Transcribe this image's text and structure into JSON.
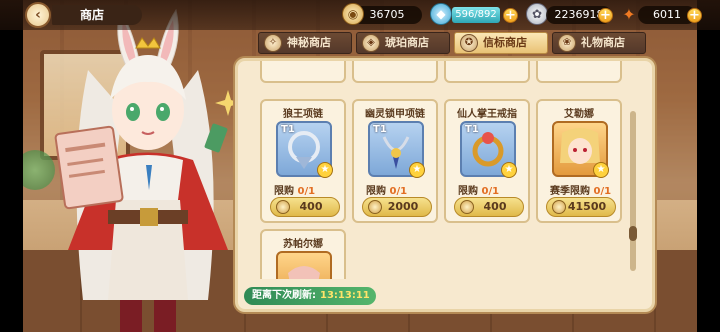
{
  "header": {
    "back_icon": "back-arrow-icon",
    "title": "商店"
  },
  "resources": [
    {
      "name": "gold",
      "value": "36705"
    },
    {
      "name": "stamina",
      "value": "596/892"
    },
    {
      "name": "silver",
      "value": "2236918"
    },
    {
      "name": "carrot",
      "value": "6011"
    }
  ],
  "tabs": [
    {
      "label": "神秘商店",
      "icon": "mystery-icon",
      "active": false
    },
    {
      "label": "琥珀商店",
      "icon": "amber-icon",
      "active": false
    },
    {
      "label": "信标商店",
      "icon": "beacon-icon",
      "active": true
    },
    {
      "label": "礼物商店",
      "icon": "gift-icon",
      "active": false
    }
  ],
  "items": [
    {
      "name": "狼王项链",
      "tier": "T1",
      "limit_label": "限购",
      "limit": "0/1",
      "price": "400",
      "frame": "blue"
    },
    {
      "name": "幽灵锁甲项链",
      "tier": "T1",
      "limit_label": "限购",
      "limit": "0/1",
      "price": "2000",
      "frame": "blue"
    },
    {
      "name": "仙人掌王戒指",
      "tier": "T1",
      "limit_label": "限购",
      "limit": "0/1",
      "price": "400",
      "frame": "blue"
    },
    {
      "name": "艾勒娜",
      "tier": "",
      "limit_label": "赛季限购",
      "limit": "0/1",
      "price": "41500",
      "frame": "gold"
    },
    {
      "name": "苏帕尔娜",
      "tier": "",
      "limit_label": "",
      "limit": "",
      "price": "",
      "frame": "gold"
    }
  ],
  "refresh": {
    "label": "距离下次刷新:",
    "time": "13:13:11"
  },
  "colors": {
    "panel_bg": "#f7e9cf",
    "tab_active": "#e9c275",
    "price_button": "#e0b949",
    "refresh_bar": "#2f8a55"
  }
}
